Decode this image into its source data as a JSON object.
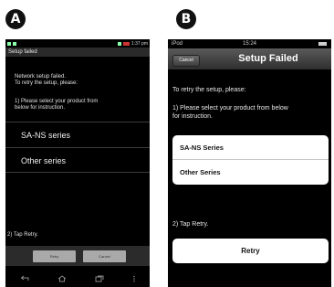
{
  "labels": {
    "a": "A",
    "b": "B"
  },
  "android": {
    "status_time": "1:37 pm",
    "title": "Setup failed",
    "message_line1": "Network setup failed.",
    "message_line2": "To retry the setup, please:",
    "select_line1": "1) Please select your product from",
    "select_line2": "below for instruction.",
    "items": [
      "SA-NS series",
      "Other series"
    ],
    "tap_text": "2) Tap Retry.",
    "retry_button": "Retry",
    "cancel_button": "Cancel",
    "nav_icons": [
      "back-icon",
      "home-icon",
      "recent-apps-icon",
      "menu-icon"
    ]
  },
  "ios": {
    "carrier": "iPod",
    "time": "15:24",
    "cancel_button": "Cancel",
    "title": "Setup Failed",
    "retry_text": "To retry the setup, please:",
    "select_line1": "1) Please select your product from below",
    "select_line2": "for instruction.",
    "items": [
      "SA-NS Series",
      "Other Series"
    ],
    "tap_text": "2) Tap Retry.",
    "retry_button": "Retry"
  }
}
